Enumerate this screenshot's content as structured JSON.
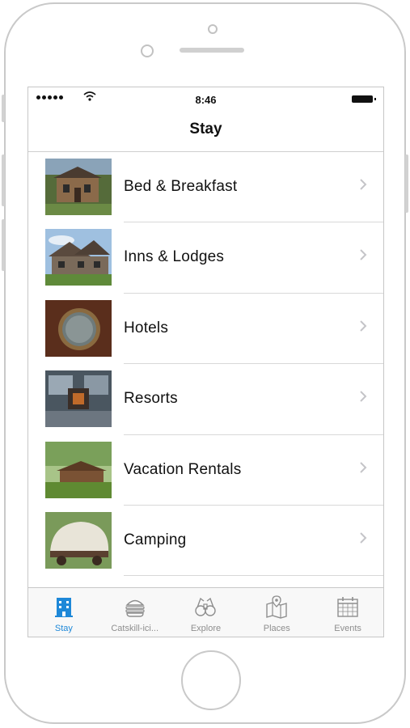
{
  "status_bar": {
    "time": "8:46"
  },
  "navbar": {
    "title": "Stay"
  },
  "categories": [
    {
      "label": "Bed & Breakfast",
      "icon": "chevron-right-icon"
    },
    {
      "label": "Inns & Lodges",
      "icon": "chevron-right-icon"
    },
    {
      "label": "Hotels",
      "icon": "chevron-right-icon"
    },
    {
      "label": "Resorts",
      "icon": "chevron-right-icon"
    },
    {
      "label": "Vacation Rentals",
      "icon": "chevron-right-icon"
    },
    {
      "label": "Camping",
      "icon": "chevron-right-icon"
    }
  ],
  "tabbar": {
    "tabs": [
      {
        "label": "Stay",
        "icon": "building-icon",
        "active": true
      },
      {
        "label": "Catskill-ici...",
        "icon": "burger-icon",
        "active": false
      },
      {
        "label": "Explore",
        "icon": "binoculars-icon",
        "active": false
      },
      {
        "label": "Places",
        "icon": "map-icon",
        "active": false
      },
      {
        "label": "Events",
        "icon": "calendar-icon",
        "active": false
      }
    ]
  },
  "colors": {
    "accent": "#1e88d8",
    "inactive": "#8e8e8e",
    "separator": "#d8d8d8"
  }
}
